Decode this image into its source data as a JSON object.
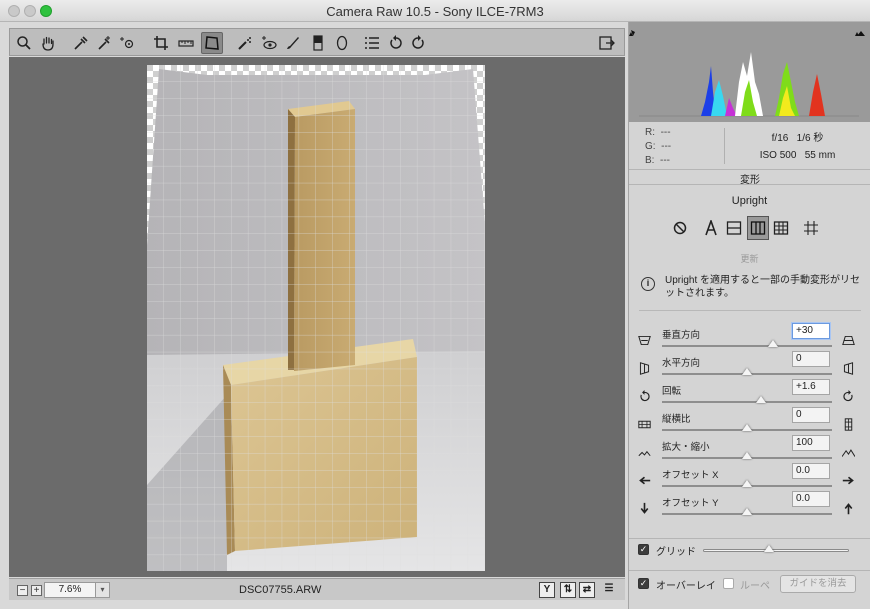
{
  "window": {
    "title": "Camera Raw 10.5  -  Sony ILCE-7RM3"
  },
  "toolbar": {
    "tools": [
      "zoom-icon",
      "hand-icon",
      "white-balance-icon",
      "color-sampler-icon",
      "targeted-adjust-icon",
      "crop-icon",
      "straighten-icon",
      "transform-icon",
      "spot-removal-icon",
      "red-eye-icon",
      "adjustment-brush-icon",
      "graduated-filter-icon",
      "radial-filter-icon",
      "preferences-icon",
      "rotate-left-icon",
      "rotate-right-icon"
    ],
    "active_tool": "transform-icon",
    "fullscreen_icon": "fullscreen-toggle-icon"
  },
  "status": {
    "zoom_value": "7.6%",
    "filename": "DSC07755.ARW"
  },
  "info": {
    "r_label": "R:",
    "r_value": "---",
    "g_label": "G:",
    "g_value": "---",
    "b_label": "B:",
    "b_value": "---",
    "aperture": "f/16",
    "shutter": "1/6 秒",
    "iso": "ISO 500",
    "focal": "55 mm"
  },
  "panel": {
    "section_title": "変形",
    "upright_label": "Upright",
    "update_label": "更新",
    "note": "Upright を適用すると一部の手動変形がリセットされます。",
    "upright_buttons": [
      "off",
      "auto",
      "level",
      "vertical",
      "full",
      "guided"
    ],
    "upright_selected": "vertical",
    "sliders": [
      {
        "label": "垂直方向",
        "value": "+30",
        "position": 0.65,
        "focused": true,
        "left_icon": "vertical-perspective-icon",
        "right_icon": "vertical-perspective-alt-icon"
      },
      {
        "label": "水平方向",
        "value": "0",
        "position": 0.5,
        "focused": false,
        "left_icon": "horizontal-perspective-icon",
        "right_icon": "horizontal-perspective-alt-icon"
      },
      {
        "label": "回転",
        "value": "+1.6",
        "position": 0.58,
        "focused": false,
        "left_icon": "rotate-ccw-icon",
        "right_icon": "rotate-cw-icon"
      },
      {
        "label": "縦横比",
        "value": "0",
        "position": 0.5,
        "focused": false,
        "left_icon": "aspect-wide-icon",
        "right_icon": "aspect-tall-icon"
      },
      {
        "label": "拡大・縮小",
        "value": "100",
        "position": 0.5,
        "focused": false,
        "left_icon": "scale-down-icon",
        "right_icon": "scale-up-icon"
      },
      {
        "label": "オフセット X",
        "value": "0.0",
        "position": 0.5,
        "focused": false,
        "left_icon": "offset-left-icon",
        "right_icon": "offset-right-icon"
      },
      {
        "label": "オフセット Y",
        "value": "0.0",
        "position": 0.5,
        "focused": false,
        "left_icon": "offset-down-icon",
        "right_icon": "offset-up-icon"
      }
    ],
    "grid_label": "グリッド",
    "grid_checked": true,
    "grid_size": 0.45,
    "overlay_label": "オーバーレイ",
    "overlay_checked": true,
    "loupe_label": "ルーペ",
    "loupe_checked": false,
    "clear_guides_label": "ガイドを消去"
  },
  "colors": {
    "histogram_red": "#e2331f",
    "histogram_green": "#7fdc1a",
    "histogram_blue": "#1c3fe8",
    "histogram_cyan": "#38d8f0",
    "histogram_yellow": "#f2ea1d",
    "histogram_magenta": "#c631d6",
    "focus_accent": "#6b9ae0"
  }
}
